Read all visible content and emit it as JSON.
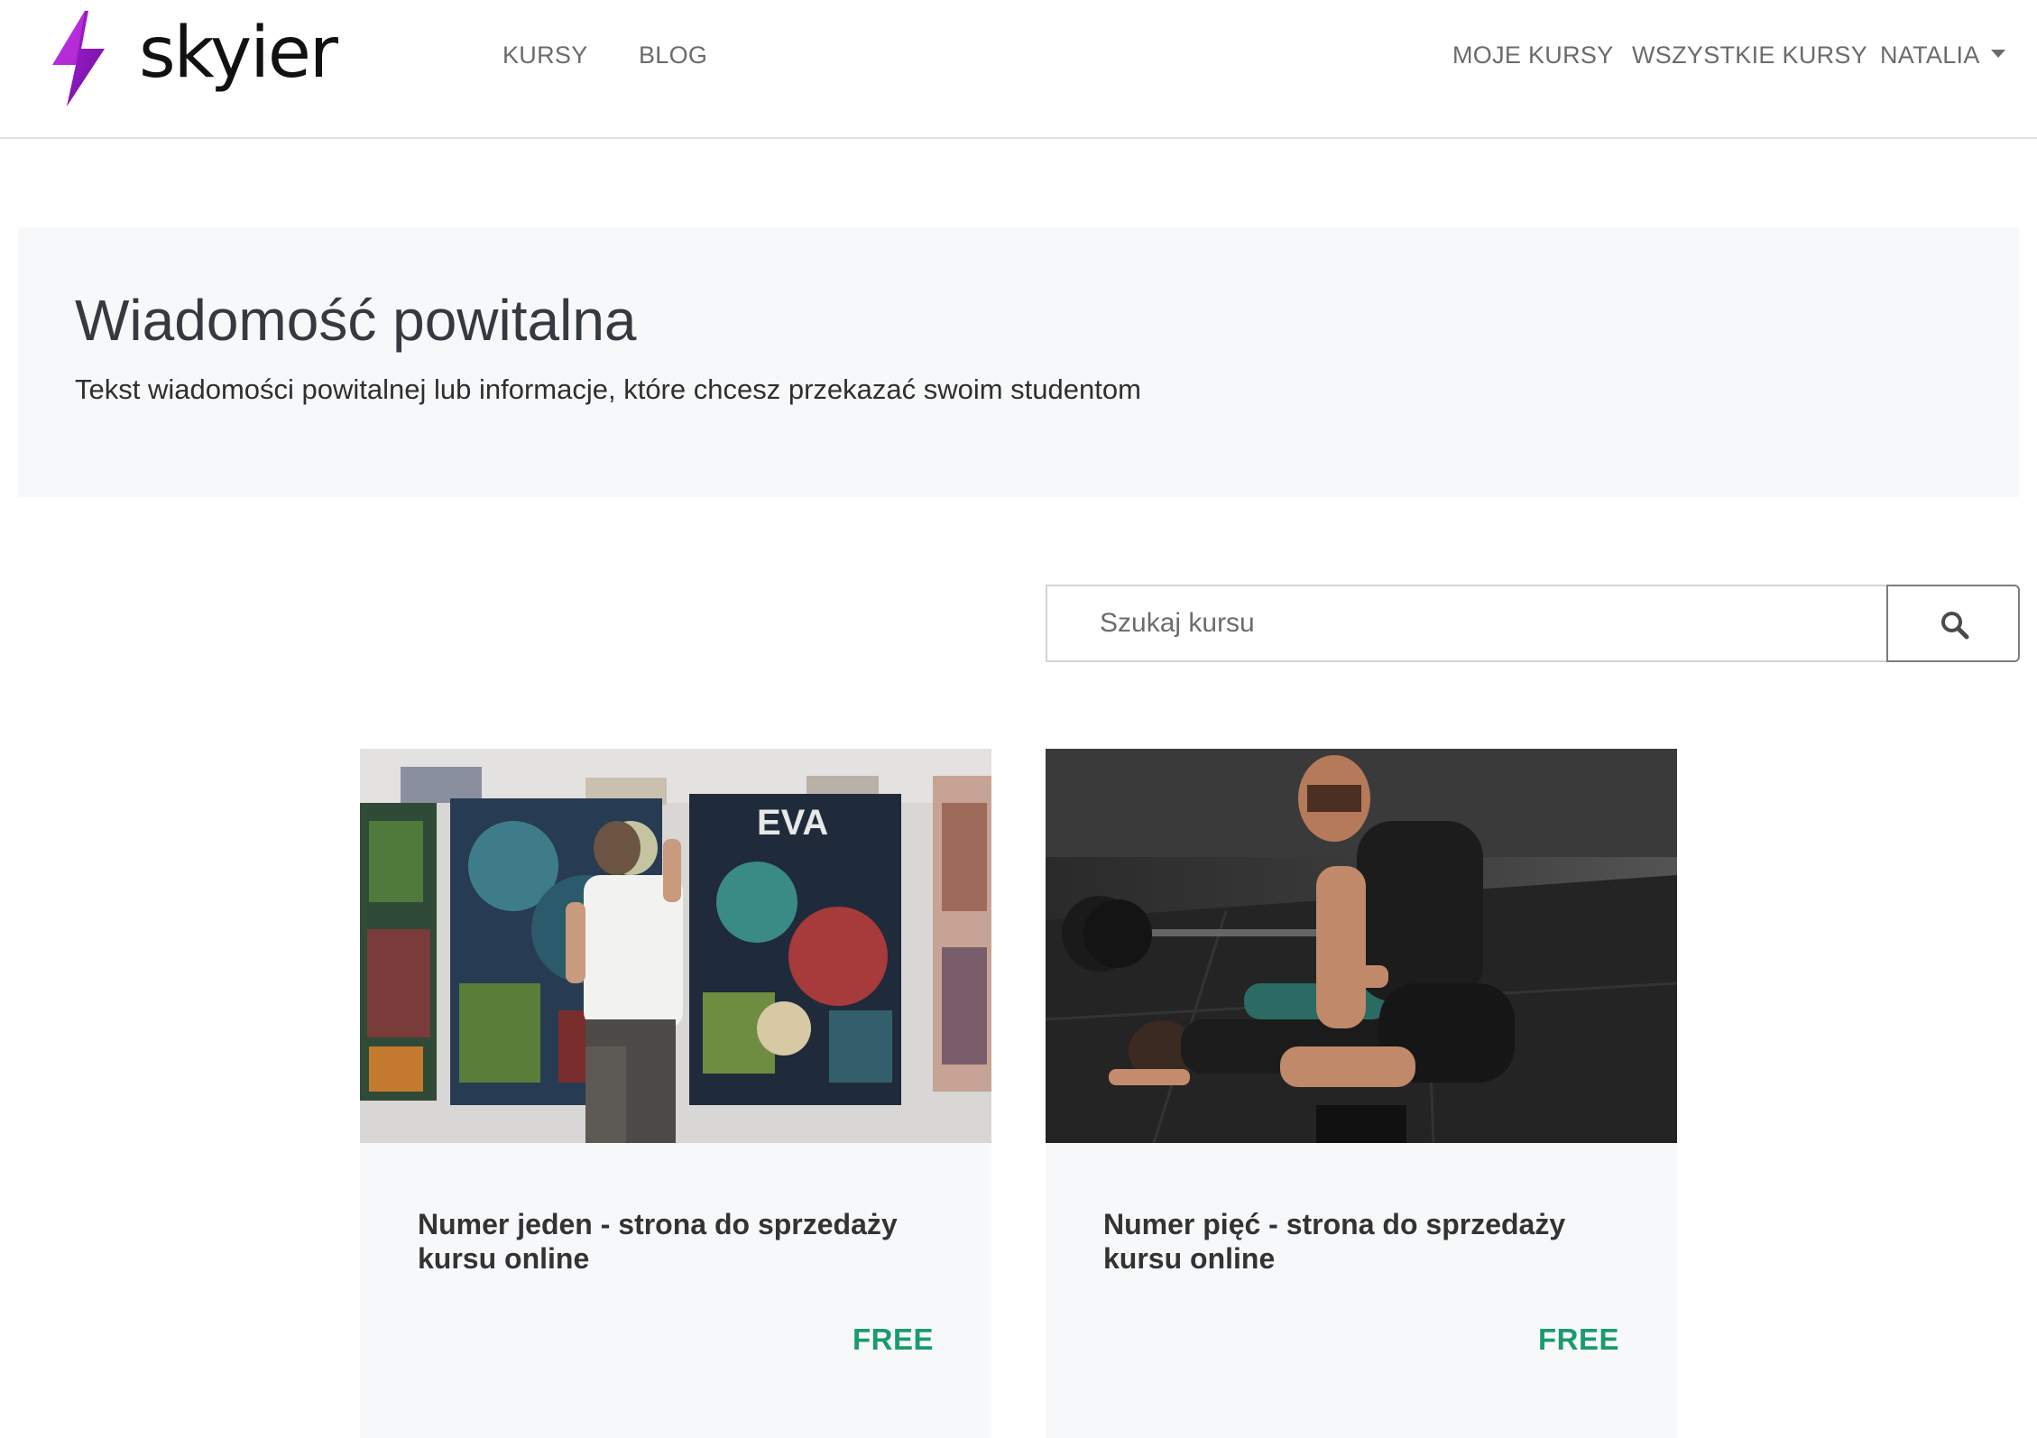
{
  "header": {
    "logo_text": "skyier",
    "nav_left": [
      "KURSY",
      "BLOG"
    ],
    "nav_right": {
      "my_courses": "MOJE KURSY",
      "all_courses": "WSZYSTKIE KURSY",
      "user": "NATALIA"
    }
  },
  "welcome": {
    "title": "Wiadomość powitalna",
    "text": "Tekst wiadomości powitalnej lub informacje, które chcesz przekazać swoim studentom"
  },
  "search": {
    "placeholder": "Szukaj kursu",
    "button_icon": "search-icon"
  },
  "courses": [
    {
      "title": "Numer jeden - strona do sprzedaży kursu online",
      "price": "FREE",
      "image": "graffiti-artist-photo"
    },
    {
      "title": "Numer pięć - strona do sprzedaży kursu online",
      "price": "FREE",
      "image": "fitness-trainer-photo"
    }
  ],
  "colors": {
    "price": "#1a9b6c",
    "nav_text": "#6b6b6b",
    "panel_bg": "#f7f8f9",
    "logo_purple": "#8e1db5"
  }
}
